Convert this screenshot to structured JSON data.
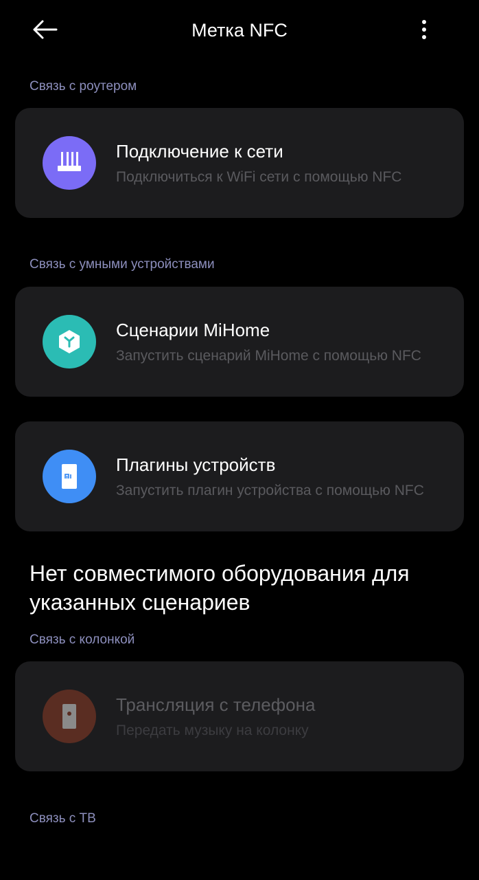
{
  "header": {
    "title": "Метка NFC",
    "back_icon": "arrow-left-icon",
    "more_icon": "more-vertical-icon"
  },
  "sections": {
    "router": {
      "label": "Связь с роутером",
      "card": {
        "title": "Подключение к сети",
        "description": "Подключиться к WiFi сети с помощью NFC",
        "icon": "router-icon",
        "icon_color": "#7b6cf6"
      }
    },
    "smart": {
      "label": "Связь с умными устройствами",
      "cards": [
        {
          "title": "Сценарии MiHome",
          "description": "Запустить сценарий MiHome с помощью NFC",
          "icon": "mihome-icon",
          "icon_color": "#2bbcb4"
        },
        {
          "title": "Плагины устройств",
          "description": "Запустить плагин устройства с помощью NFC",
          "icon": "mi-device-icon",
          "icon_color": "#3f8ef5"
        }
      ]
    },
    "notice": "Нет совместимого оборудования для указанных сценариев",
    "speaker": {
      "label": "Связь с колонкой",
      "card": {
        "title": "Трансляция с телефона",
        "description": "Передать музыку на колонку",
        "icon": "speaker-icon",
        "icon_color": "#5a2d22",
        "enabled": false
      }
    },
    "tv": {
      "label": "Связь с ТВ"
    }
  }
}
